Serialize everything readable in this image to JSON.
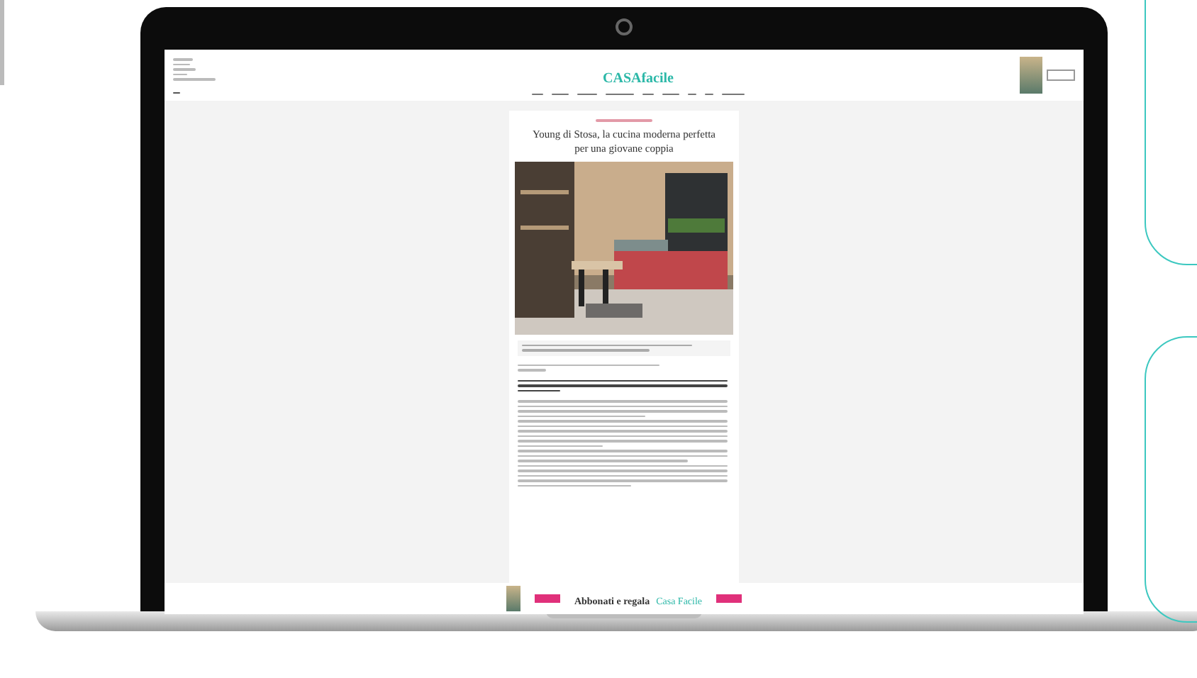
{
  "site": {
    "logo": "CASAfacile"
  },
  "article": {
    "title": "Young di Stosa, la cucina moderna perfetta per una giovane coppia"
  },
  "banner": {
    "text": "Abbonati e regala",
    "brand": "Casa Facile"
  }
}
